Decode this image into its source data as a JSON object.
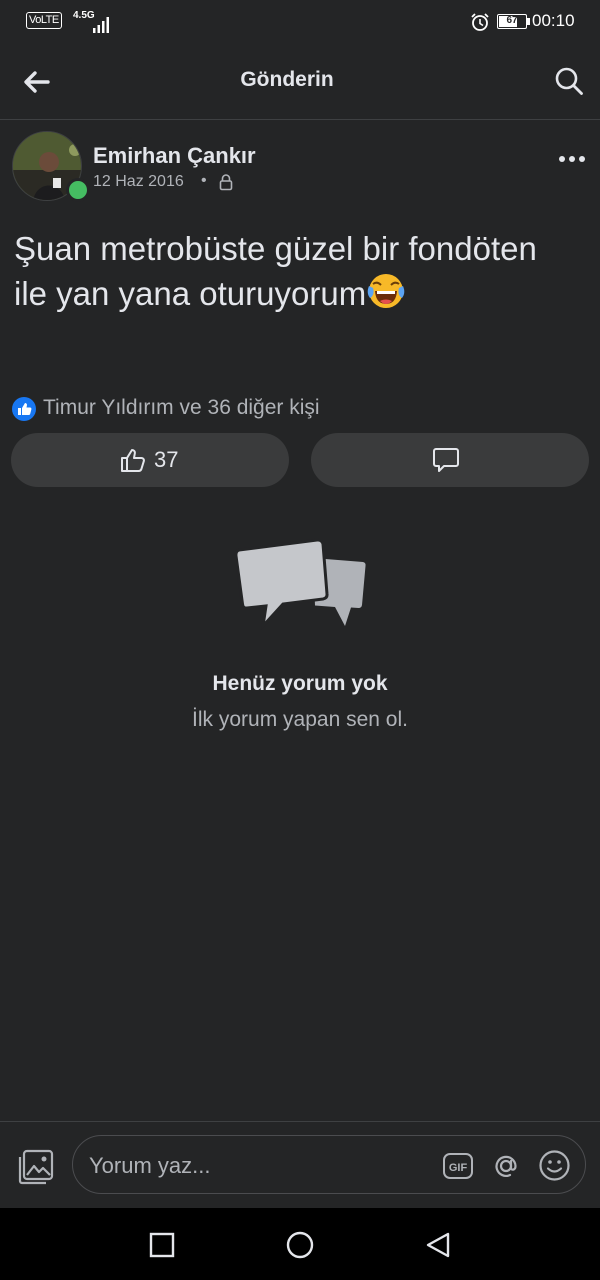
{
  "status_bar": {
    "volte": "VoLTE",
    "network": "4.5G",
    "battery": "67",
    "time": "00:10",
    "icons": [
      "signal-icon",
      "alarm-icon",
      "battery-icon"
    ]
  },
  "header": {
    "title": "Gönderin",
    "icons": [
      "back-arrow-icon",
      "search-icon"
    ]
  },
  "post": {
    "author": "Emirhan Çankır",
    "date": "12 Haz 2016",
    "separator": "•",
    "privacy_icon": "lock-icon",
    "text": "Şuan metrobüste güzel bir fondöten ile yan yana oturuyorum",
    "emoji": "tears-of-joy-emoji"
  },
  "reactions": {
    "summary": "Timur Yıldırım ve 36 diğer kişi",
    "like_count": "37"
  },
  "empty_state": {
    "title": "Henüz yorum yok",
    "subtitle": "İlk yorum yapan sen ol."
  },
  "composer": {
    "placeholder": "Yorum yaz...",
    "icons": [
      "photo-icon",
      "gif-icon",
      "mention-icon",
      "smiley-icon"
    ]
  },
  "nav": {
    "icons": [
      "recent-apps-icon",
      "home-icon",
      "back-icon"
    ]
  },
  "colors": {
    "background": "#242526",
    "surface": "#3a3b3c",
    "text_primary": "#e4e6eb",
    "text_secondary": "#b0b3b8",
    "online": "#45bd62",
    "like_blue": "#1877f2"
  }
}
